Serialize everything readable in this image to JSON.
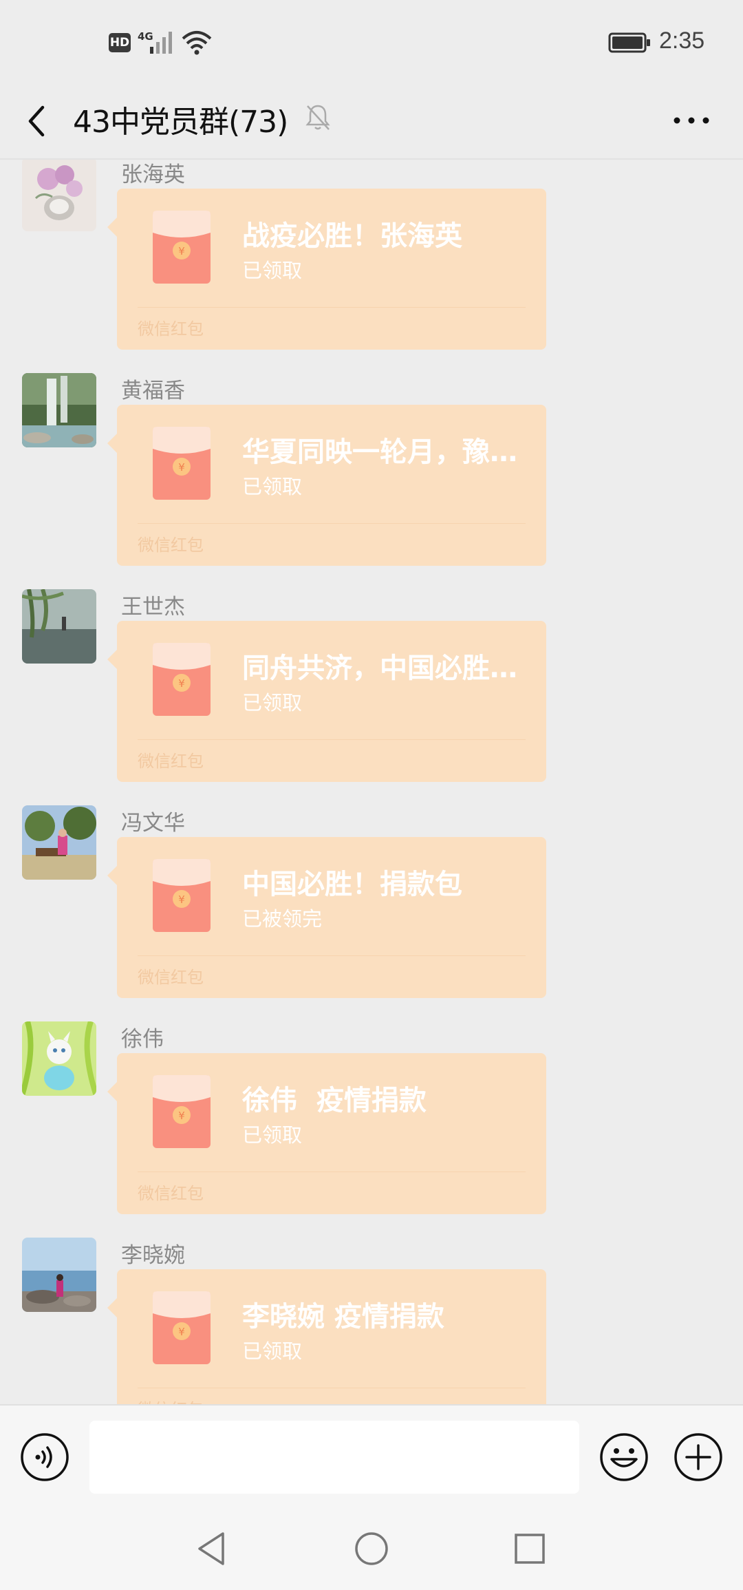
{
  "status_bar": {
    "hd": "HD",
    "network": "4G",
    "time": "2:35",
    "icons": [
      "signal-icon",
      "wifi-icon",
      "battery-icon"
    ]
  },
  "header": {
    "title": "43中党员群(73)",
    "icons": [
      "back-icon",
      "mute-bell-icon",
      "more-icon"
    ]
  },
  "messages": [
    {
      "sender": "张海英",
      "wish": "战疫必胜！张海英",
      "status": "已领取",
      "label": "微信红包"
    },
    {
      "sender": "黄福香",
      "wish": "华夏同映一轮月，豫…",
      "status": "已领取",
      "label": "微信红包"
    },
    {
      "sender": "王世杰",
      "wish": "同舟共济，中国必胜…",
      "status": "已领取",
      "label": "微信红包"
    },
    {
      "sender": "冯文华",
      "wish": "中国必胜！捐款包",
      "status": "已被领完",
      "label": "微信红包"
    },
    {
      "sender": "徐伟",
      "wish": "徐伟  疫情捐款",
      "status": "已领取",
      "label": "微信红包"
    },
    {
      "sender": "李晓婉",
      "wish": "李晓婉 疫情捐款",
      "status": "已领取",
      "label": "微信红包"
    }
  ],
  "input_bar": {
    "value": "",
    "icons": [
      "voice-icon",
      "emoji-icon",
      "plus-icon"
    ]
  },
  "system_nav": {
    "icons": [
      "nav-back-icon",
      "nav-home-icon",
      "nav-recent-icon"
    ]
  },
  "colors": {
    "background": "#ededed",
    "packet": "#fbdfc0",
    "packet_red": "#f9907f",
    "packet_coin": "#fcc582"
  }
}
